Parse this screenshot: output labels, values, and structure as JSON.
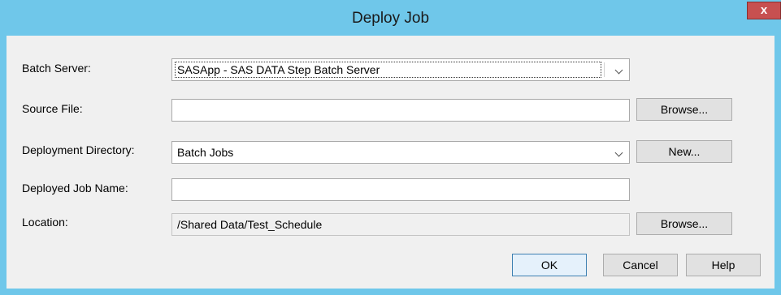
{
  "window": {
    "title": "Deploy Job",
    "close_glyph": "x"
  },
  "form": {
    "batch_server": {
      "label": "Batch Server:",
      "value": "SASApp - SAS DATA Step Batch Server"
    },
    "source_file": {
      "label": "Source File:",
      "value": "",
      "browse_label": "Browse..."
    },
    "deployment_directory": {
      "label": "Deployment Directory:",
      "value": "Batch Jobs",
      "new_label": "New..."
    },
    "deployed_job_name": {
      "label": "Deployed Job Name:",
      "value": ""
    },
    "location": {
      "label": "Location:",
      "value": "/Shared Data/Test_Schedule",
      "browse_label": "Browse..."
    }
  },
  "buttons": {
    "ok_label": "OK",
    "cancel_label": "Cancel",
    "help_label": "Help"
  },
  "icons": {
    "dropdown": "chevron-down-icon",
    "close": "close-icon"
  },
  "colors": {
    "titlebar": "#6fc7ea",
    "client": "#f0f0f0",
    "close_button": "#c75050"
  }
}
